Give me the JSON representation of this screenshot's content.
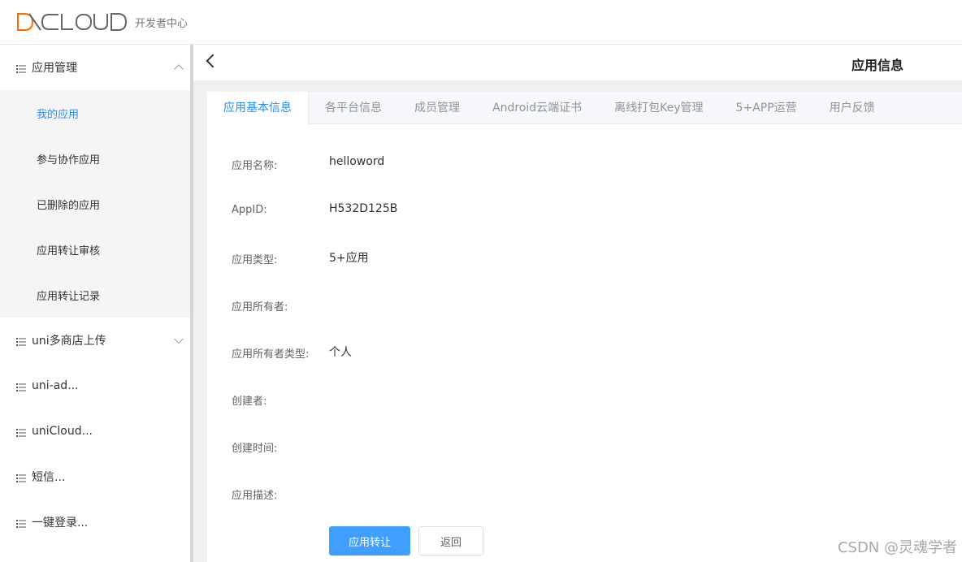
{
  "header": {
    "logo_text": "DCLOUD",
    "subtitle": "开发者中心",
    "logo_accent": "#ff6a00"
  },
  "sidebar": {
    "groups": [
      {
        "label": "应用管理",
        "expanded": true,
        "items": [
          {
            "label": "我的应用",
            "active": true
          },
          {
            "label": "参与协作应用"
          },
          {
            "label": "已删除的应用"
          },
          {
            "label": "应用转让审核"
          },
          {
            "label": "应用转让记录"
          }
        ]
      },
      {
        "label": "uni多商店上传",
        "expanded": false
      },
      {
        "label": "uni-ad..."
      },
      {
        "label": "uniCloud..."
      },
      {
        "label": "短信..."
      },
      {
        "label": "一键登录..."
      }
    ]
  },
  "page": {
    "title": "应用信息"
  },
  "tabs": [
    {
      "label": "应用基本信息",
      "active": true
    },
    {
      "label": "各平台信息"
    },
    {
      "label": "成员管理"
    },
    {
      "label": "Android云端证书"
    },
    {
      "label": "离线打包Key管理"
    },
    {
      "label": "5+APP运营"
    },
    {
      "label": "用户反馈"
    }
  ],
  "form": {
    "fields": [
      {
        "label": "应用名称:",
        "value": "helloword"
      },
      {
        "label": "AppID:",
        "value": "H532D125B"
      },
      {
        "label": "应用类型:",
        "value": "5+应用"
      },
      {
        "label": "应用所有者:",
        "value": ""
      },
      {
        "label": "应用所有者类型:",
        "value": "个人"
      },
      {
        "label": "创建者:",
        "value": ""
      },
      {
        "label": "创建时间:",
        "value": ""
      },
      {
        "label": "应用描述:",
        "value": ""
      }
    ],
    "primary_button": "应用转让",
    "secondary_button": "返回"
  },
  "watermark": "CSDN @灵魂学者",
  "colors": {
    "primary": "#409eff",
    "active_link": "#2d8cf0"
  }
}
